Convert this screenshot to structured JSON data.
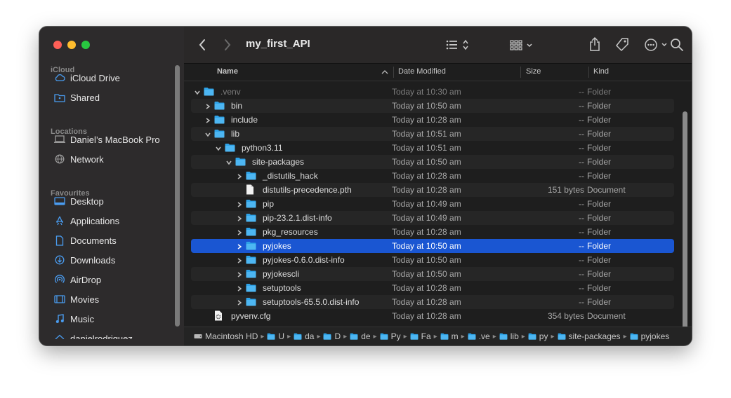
{
  "window": {
    "title": "my_first_API"
  },
  "sidebar": {
    "sections": [
      {
        "title": "iCloud",
        "items": [
          {
            "label": "iCloud Drive",
            "icon": "cloud-icon"
          },
          {
            "label": "Shared",
            "icon": "shared-folder-icon"
          }
        ]
      },
      {
        "title": "Locations",
        "items": [
          {
            "label": "Daniel’s MacBook Pro",
            "icon": "laptop-icon"
          },
          {
            "label": "Network",
            "icon": "globe-icon"
          }
        ]
      },
      {
        "title": "Favourites",
        "items": [
          {
            "label": "Desktop",
            "icon": "desktop-icon"
          },
          {
            "label": "Applications",
            "icon": "applications-icon"
          },
          {
            "label": "Documents",
            "icon": "document-icon"
          },
          {
            "label": "Downloads",
            "icon": "download-icon"
          },
          {
            "label": "AirDrop",
            "icon": "airdrop-icon"
          },
          {
            "label": "Movies",
            "icon": "film-icon"
          },
          {
            "label": "Music",
            "icon": "music-note-icon"
          },
          {
            "label": "danielrodriguez",
            "icon": "home-icon"
          }
        ]
      }
    ]
  },
  "columns": {
    "name": "Name",
    "date": "Date Modified",
    "size": "Size",
    "kind": "Kind"
  },
  "rows": [
    {
      "name": ".venv",
      "date": "Today at 10:30 am",
      "size": "--",
      "kind": "Folder",
      "type": "folder",
      "depth": 0,
      "chevron": "down",
      "dim": true
    },
    {
      "name": "bin",
      "date": "Today at 10:50 am",
      "size": "--",
      "kind": "Folder",
      "type": "folder",
      "depth": 1,
      "chevron": "right"
    },
    {
      "name": "include",
      "date": "Today at 10:28 am",
      "size": "--",
      "kind": "Folder",
      "type": "folder",
      "depth": 1,
      "chevron": "right"
    },
    {
      "name": "lib",
      "date": "Today at 10:51 am",
      "size": "--",
      "kind": "Folder",
      "type": "folder",
      "depth": 1,
      "chevron": "down"
    },
    {
      "name": "python3.11",
      "date": "Today at 10:51 am",
      "size": "--",
      "kind": "Folder",
      "type": "folder",
      "depth": 2,
      "chevron": "down"
    },
    {
      "name": "site-packages",
      "date": "Today at 10:50 am",
      "size": "--",
      "kind": "Folder",
      "type": "folder",
      "depth": 3,
      "chevron": "down"
    },
    {
      "name": "_distutils_hack",
      "date": "Today at 10:28 am",
      "size": "--",
      "kind": "Folder",
      "type": "folder",
      "depth": 4,
      "chevron": "right"
    },
    {
      "name": "distutils-precedence.pth",
      "date": "Today at 10:28 am",
      "size": "151 bytes",
      "kind": "Document",
      "type": "file",
      "depth": 4,
      "chevron": "none"
    },
    {
      "name": "pip",
      "date": "Today at 10:49 am",
      "size": "--",
      "kind": "Folder",
      "type": "folder",
      "depth": 4,
      "chevron": "right"
    },
    {
      "name": "pip-23.2.1.dist-info",
      "date": "Today at 10:49 am",
      "size": "--",
      "kind": "Folder",
      "type": "folder",
      "depth": 4,
      "chevron": "right"
    },
    {
      "name": "pkg_resources",
      "date": "Today at 10:28 am",
      "size": "--",
      "kind": "Folder",
      "type": "folder",
      "depth": 4,
      "chevron": "right"
    },
    {
      "name": "pyjokes",
      "date": "Today at 10:50 am",
      "size": "--",
      "kind": "Folder",
      "type": "folder",
      "depth": 4,
      "chevron": "right",
      "selected": true
    },
    {
      "name": "pyjokes-0.6.0.dist-info",
      "date": "Today at 10:50 am",
      "size": "--",
      "kind": "Folder",
      "type": "folder",
      "depth": 4,
      "chevron": "right"
    },
    {
      "name": "pyjokescli",
      "date": "Today at 10:50 am",
      "size": "--",
      "kind": "Folder",
      "type": "folder",
      "depth": 4,
      "chevron": "right"
    },
    {
      "name": "setuptools",
      "date": "Today at 10:28 am",
      "size": "--",
      "kind": "Folder",
      "type": "folder",
      "depth": 4,
      "chevron": "right"
    },
    {
      "name": "setuptools-65.5.0.dist-info",
      "date": "Today at 10:28 am",
      "size": "--",
      "kind": "Folder",
      "type": "folder",
      "depth": 4,
      "chevron": "right"
    },
    {
      "name": "pyvenv.cfg",
      "date": "Today at 10:28 am",
      "size": "354 bytes",
      "kind": "Document",
      "type": "config",
      "depth": 1,
      "chevron": "none"
    }
  ],
  "pathbar": [
    {
      "label": "Macintosh HD",
      "icon": "disk-icon"
    },
    {
      "label": "U",
      "icon": "folder-icon"
    },
    {
      "label": "da",
      "icon": "folder-icon"
    },
    {
      "label": "D",
      "icon": "folder-icon"
    },
    {
      "label": "de",
      "icon": "folder-icon"
    },
    {
      "label": "Py",
      "icon": "folder-icon"
    },
    {
      "label": "Fa",
      "icon": "folder-icon"
    },
    {
      "label": "m",
      "icon": "folder-icon"
    },
    {
      "label": ".ve",
      "icon": "folder-icon"
    },
    {
      "label": "lib",
      "icon": "folder-icon"
    },
    {
      "label": "py",
      "icon": "folder-icon"
    },
    {
      "label": "site-packages",
      "icon": "folder-icon"
    },
    {
      "label": "pyjokes",
      "icon": "folder-icon"
    }
  ],
  "colors": {
    "selection": "#1a56d2",
    "folder": "#2ea3e8",
    "red": "#fe5f57",
    "yellow": "#febc2e",
    "green": "#28c840"
  }
}
